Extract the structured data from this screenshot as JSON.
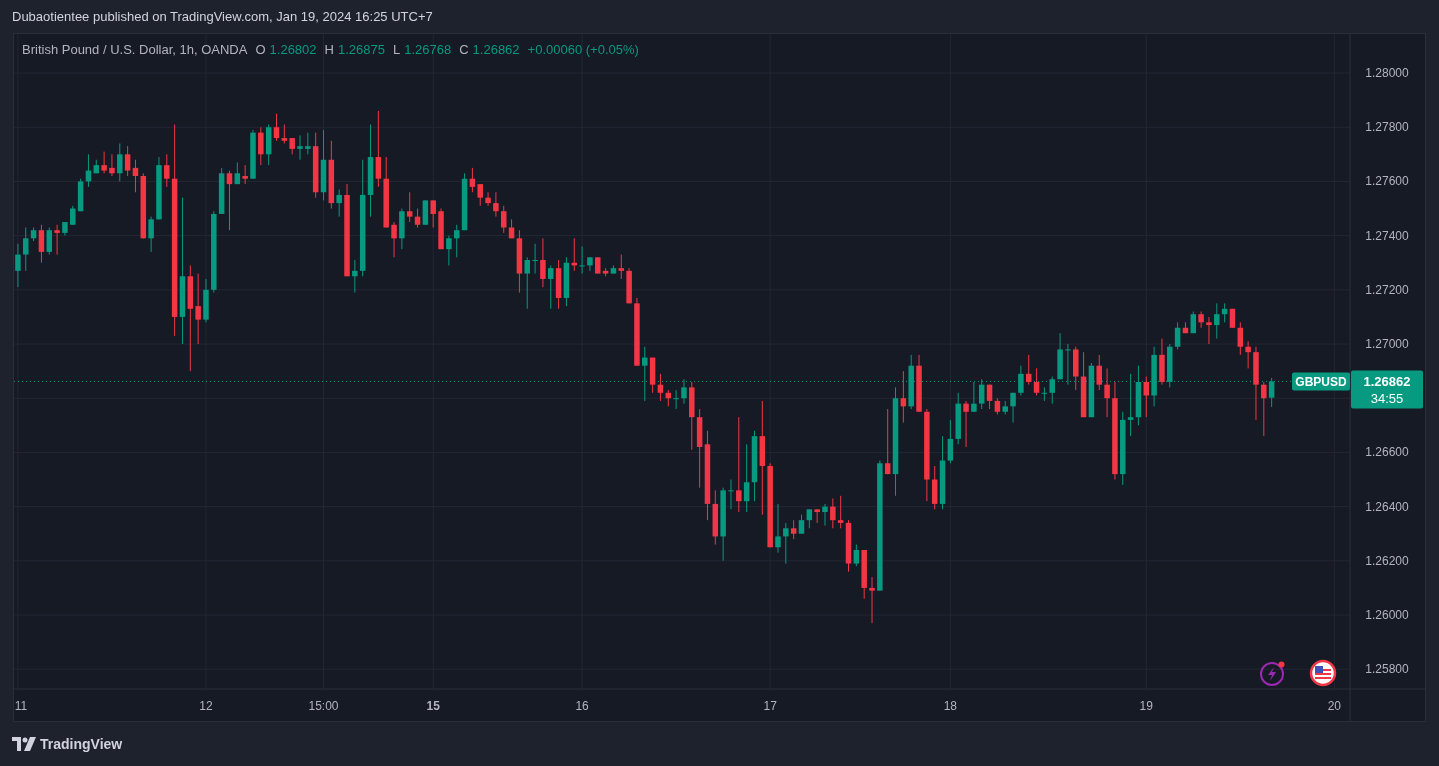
{
  "header": {
    "text": "Dubaotientee published on TradingView.com, Jan 19, 2024 16:25 UTC+7"
  },
  "legend": {
    "title": "British Pound / U.S. Dollar, 1h, OANDA",
    "ohlc": [
      {
        "label": "O",
        "value": "1.26802"
      },
      {
        "label": "H",
        "value": "1.26875"
      },
      {
        "label": "L",
        "value": "1.26768"
      },
      {
        "label": "C",
        "value": "1.26862"
      }
    ],
    "change": "+0.00060 (+0.05%)"
  },
  "price_tag": {
    "price": "1.26862",
    "countdown": "34:55"
  },
  "chart_data": {
    "type": "candlestick",
    "grid": true,
    "ref_lines": [
      {
        "axis": "y",
        "value": 1.26862
      }
    ],
    "ylim": [
      1.25727,
      1.28144
    ],
    "yticks": [
      {
        "value": 1.258,
        "label": "1.25800"
      },
      {
        "value": 1.26,
        "label": "1.26000"
      },
      {
        "value": 1.262,
        "label": "1.26200"
      },
      {
        "value": 1.264,
        "label": "1.26400"
      },
      {
        "value": 1.266,
        "label": "1.26600"
      },
      {
        "value": 1.27,
        "label": "1.27000"
      },
      {
        "value": 1.272,
        "label": "1.27200"
      },
      {
        "value": 1.274,
        "label": "1.27400"
      },
      {
        "value": 1.276,
        "label": "1.27600"
      },
      {
        "value": 1.278,
        "label": "1.27800"
      },
      {
        "value": 1.28,
        "label": "1.28000"
      }
    ],
    "categories": [
      "11",
      null,
      null,
      null,
      null,
      null,
      null,
      null,
      null,
      null,
      null,
      null,
      null,
      null,
      null,
      null,
      null,
      null,
      null,
      null,
      null,
      null,
      null,
      null,
      "12",
      null,
      null,
      null,
      null,
      null,
      null,
      null,
      null,
      null,
      null,
      null,
      null,
      null,
      null,
      "15:00",
      null,
      null,
      null,
      null,
      null,
      null,
      null,
      null,
      null,
      null,
      null,
      null,
      null,
      "**15**",
      null,
      null,
      null,
      null,
      null,
      null,
      null,
      null,
      null,
      null,
      null,
      null,
      null,
      null,
      null,
      null,
      null,
      null,
      "16",
      null,
      null,
      null,
      null,
      null,
      null,
      null,
      null,
      null,
      null,
      null,
      null,
      null,
      null,
      null,
      null,
      null,
      null,
      null,
      null,
      null,
      null,
      null,
      "17",
      null,
      null,
      null,
      null,
      null,
      null,
      null,
      null,
      null,
      null,
      null,
      null,
      null,
      null,
      null,
      null,
      null,
      null,
      null,
      null,
      null,
      null,
      "18",
      null,
      null,
      null,
      null,
      null,
      null,
      null,
      null,
      null,
      null,
      null,
      null,
      null,
      null,
      null,
      null,
      null,
      null,
      null,
      null,
      null,
      null,
      null,
      null,
      "19",
      null,
      null,
      null,
      null,
      null,
      null,
      null,
      null,
      null,
      null,
      null,
      null,
      null,
      null,
      null,
      null,
      null,
      null,
      null,
      null,
      null,
      null,
      null,
      "20"
    ],
    "series": [
      {
        "name": "GBPUSD",
        "ohlc": [
          [
            1.2727,
            1.2737,
            1.2721,
            1.2733
          ],
          [
            1.2733,
            1.2743,
            1.2727,
            1.2739
          ],
          [
            1.2739,
            1.2743,
            1.2738,
            1.2742
          ],
          [
            1.2742,
            1.2744,
            1.273,
            1.2734
          ],
          [
            1.2734,
            1.2743,
            1.2733,
            1.2742
          ],
          [
            1.2742,
            1.2744,
            1.2733,
            1.2741
          ],
          [
            1.2741,
            1.2745,
            1.274,
            1.2745
          ],
          [
            1.2744,
            1.2751,
            1.2744,
            1.275
          ],
          [
            1.2749,
            1.2761,
            1.2749,
            1.276
          ],
          [
            1.276,
            1.277,
            1.2758,
            1.2764
          ],
          [
            1.2763,
            1.2768,
            1.2763,
            1.2766
          ],
          [
            1.2766,
            1.2771,
            1.2763,
            1.2764
          ],
          [
            1.2765,
            1.277,
            1.2762,
            1.2763
          ],
          [
            1.2763,
            1.2774,
            1.276,
            1.277
          ],
          [
            1.277,
            1.2773,
            1.2762,
            1.2764
          ],
          [
            1.2765,
            1.2768,
            1.2756,
            1.2762
          ],
          [
            1.2762,
            1.2763,
            1.2739,
            1.2739
          ],
          [
            1.2739,
            1.2747,
            1.2734,
            1.2746
          ],
          [
            1.2746,
            1.2769,
            1.2746,
            1.2766
          ],
          [
            1.2766,
            1.277,
            1.2758,
            1.2761
          ],
          [
            1.2761,
            1.2781,
            1.2703,
            1.271
          ],
          [
            1.271,
            1.2754,
            1.27,
            1.2725
          ],
          [
            1.2725,
            1.2729,
            1.269,
            1.2713
          ],
          [
            1.2714,
            1.2726,
            1.27,
            1.2709
          ],
          [
            1.2709,
            1.2724,
            1.2708,
            1.272
          ],
          [
            1.272,
            1.2749,
            1.2719,
            1.2748
          ],
          [
            1.2748,
            1.2765,
            1.2748,
            1.2763
          ],
          [
            1.2763,
            1.2764,
            1.2742,
            1.2759
          ],
          [
            1.2759,
            1.2767,
            1.2759,
            1.2763
          ],
          [
            1.2762,
            1.2766,
            1.2759,
            1.2761
          ],
          [
            1.2761,
            1.2779,
            1.2761,
            1.2778
          ],
          [
            1.2778,
            1.278,
            1.2766,
            1.277
          ],
          [
            1.277,
            1.2781,
            1.2766,
            1.278
          ],
          [
            1.278,
            1.2785,
            1.2775,
            1.2776
          ],
          [
            1.2776,
            1.2781,
            1.2774,
            1.2775
          ],
          [
            1.2776,
            1.2776,
            1.277,
            1.2772
          ],
          [
            1.2772,
            1.2777,
            1.2768,
            1.2773
          ],
          [
            1.2772,
            1.2778,
            1.277,
            1.2773
          ],
          [
            1.2773,
            1.2778,
            1.2754,
            1.2756
          ],
          [
            1.2756,
            1.2779,
            1.2753,
            1.2768
          ],
          [
            1.2768,
            1.2775,
            1.275,
            1.2752
          ],
          [
            1.2752,
            1.2757,
            1.2747,
            1.2755
          ],
          [
            1.2755,
            1.2759,
            1.2725,
            1.2725
          ],
          [
            1.2725,
            1.2731,
            1.2719,
            1.2727
          ],
          [
            1.2727,
            1.2768,
            1.2725,
            1.2755
          ],
          [
            1.2755,
            1.2781,
            1.2747,
            1.2769
          ],
          [
            1.2769,
            1.2786,
            1.2758,
            1.2761
          ],
          [
            1.2761,
            1.2769,
            1.2743,
            1.2743
          ],
          [
            1.2744,
            1.2745,
            1.2732,
            1.2739
          ],
          [
            1.2739,
            1.275,
            1.2735,
            1.2749
          ],
          [
            1.2749,
            1.2756,
            1.2745,
            1.2747
          ],
          [
            1.2747,
            1.275,
            1.2743,
            1.2744
          ],
          [
            1.2744,
            1.2753,
            1.2744,
            1.2753
          ],
          [
            1.2753,
            1.2753,
            1.2743,
            1.2748
          ],
          [
            1.2749,
            1.275,
            1.2735,
            1.2735
          ],
          [
            1.2735,
            1.274,
            1.2729,
            1.2739
          ],
          [
            1.2739,
            1.2744,
            1.2732,
            1.2742
          ],
          [
            1.2742,
            1.2763,
            1.2742,
            1.2761
          ],
          [
            1.2761,
            1.2765,
            1.2756,
            1.2758
          ],
          [
            1.2759,
            1.2759,
            1.2751,
            1.2754
          ],
          [
            1.2754,
            1.2756,
            1.2751,
            1.2752
          ],
          [
            1.2752,
            1.2756,
            1.2747,
            1.2749
          ],
          [
            1.2749,
            1.2751,
            1.2741,
            1.2743
          ],
          [
            1.2743,
            1.2746,
            1.2739,
            1.2739
          ],
          [
            1.2739,
            1.2742,
            1.2719,
            1.2726
          ],
          [
            1.2726,
            1.2732,
            1.2713,
            1.2731
          ],
          [
            1.2731,
            1.2737,
            1.2726,
            1.2731
          ],
          [
            1.2731,
            1.2739,
            1.2721,
            1.2724
          ],
          [
            1.2724,
            1.2729,
            1.2713,
            1.2728
          ],
          [
            1.2728,
            1.2731,
            1.2713,
            1.2717
          ],
          [
            1.2717,
            1.2732,
            1.2714,
            1.273
          ],
          [
            1.273,
            1.2739,
            1.2727,
            1.2729
          ],
          [
            1.2729,
            1.2736,
            1.2726,
            1.2729
          ],
          [
            1.2729,
            1.2732,
            1.2727,
            1.2732
          ],
          [
            1.2732,
            1.2732,
            1.2726,
            1.2726
          ],
          [
            1.2727,
            1.2728,
            1.2725,
            1.2726
          ],
          [
            1.2726,
            1.2729,
            1.2726,
            1.2728
          ],
          [
            1.2728,
            1.2733,
            1.2724,
            1.2727
          ],
          [
            1.2727,
            1.2728,
            1.2715,
            1.2715
          ],
          [
            1.2715,
            1.2717,
            1.2692,
            1.2692
          ],
          [
            1.2692,
            1.2699,
            1.2679,
            1.2695
          ],
          [
            1.2695,
            1.2695,
            1.2682,
            1.2685
          ],
          [
            1.2685,
            1.2689,
            1.2679,
            1.2682
          ],
          [
            1.2682,
            1.2683,
            1.2677,
            1.268
          ],
          [
            1.268,
            1.2683,
            1.2676,
            1.268
          ],
          [
            1.268,
            1.2687,
            1.2678,
            1.2684
          ],
          [
            1.2684,
            1.2686,
            1.2661,
            1.2673
          ],
          [
            1.2673,
            1.2676,
            1.2647,
            1.2662
          ],
          [
            1.2663,
            1.2668,
            1.2635,
            1.2641
          ],
          [
            1.2641,
            1.2646,
            1.2626,
            1.2629
          ],
          [
            1.2629,
            1.2647,
            1.262,
            1.2646
          ],
          [
            1.2646,
            1.265,
            1.2639,
            1.2646
          ],
          [
            1.2646,
            1.2673,
            1.2638,
            1.2642
          ],
          [
            1.2642,
            1.2663,
            1.2638,
            1.2649
          ],
          [
            1.2649,
            1.2668,
            1.2642,
            1.2666
          ],
          [
            1.2666,
            1.2679,
            1.2637,
            1.2655
          ],
          [
            1.2655,
            1.2656,
            1.2625,
            1.2625
          ],
          [
            1.2625,
            1.2641,
            1.2623,
            1.2629
          ],
          [
            1.2629,
            1.2634,
            1.2619,
            1.2632
          ],
          [
            1.2632,
            1.2635,
            1.2628,
            1.263
          ],
          [
            1.263,
            1.2637,
            1.263,
            1.2635
          ],
          [
            1.2635,
            1.2639,
            1.2632,
            1.2639
          ],
          [
            1.2639,
            1.2639,
            1.2634,
            1.2638
          ],
          [
            1.2638,
            1.2641,
            1.2633,
            1.264
          ],
          [
            1.264,
            1.2643,
            1.2632,
            1.2635
          ],
          [
            1.2635,
            1.2644,
            1.2632,
            1.2634
          ],
          [
            1.2634,
            1.2635,
            1.2616,
            1.2619
          ],
          [
            1.2619,
            1.2626,
            1.2618,
            1.2624
          ],
          [
            1.2624,
            1.2624,
            1.2606,
            1.261
          ],
          [
            1.261,
            1.2614,
            1.2597,
            1.2609
          ],
          [
            1.2609,
            1.2657,
            1.2609,
            1.2656
          ],
          [
            1.2656,
            1.2676,
            1.2652,
            1.2652
          ],
          [
            1.2652,
            1.2684,
            1.2644,
            1.268
          ],
          [
            1.268,
            1.269,
            1.2671,
            1.2677
          ],
          [
            1.2677,
            1.2696,
            1.2676,
            1.2692
          ],
          [
            1.2692,
            1.2696,
            1.2675,
            1.2675
          ],
          [
            1.2675,
            1.2676,
            1.2642,
            1.265
          ],
          [
            1.265,
            1.2655,
            1.2639,
            1.2641
          ],
          [
            1.2641,
            1.2666,
            1.2639,
            1.2657
          ],
          [
            1.2657,
            1.2672,
            1.2656,
            1.2665
          ],
          [
            1.2665,
            1.2682,
            1.2663,
            1.2678
          ],
          [
            1.2678,
            1.2679,
            1.2662,
            1.2675
          ],
          [
            1.2675,
            1.2686,
            1.2675,
            1.2678
          ],
          [
            1.2678,
            1.2687,
            1.2676,
            1.2685
          ],
          [
            1.2685,
            1.2685,
            1.2676,
            1.2679
          ],
          [
            1.2679,
            1.268,
            1.2674,
            1.2675
          ],
          [
            1.2675,
            1.2679,
            1.2674,
            1.2677
          ],
          [
            1.2677,
            1.2682,
            1.2671,
            1.2682
          ],
          [
            1.2682,
            1.2692,
            1.2681,
            1.2689
          ],
          [
            1.2689,
            1.2696,
            1.2685,
            1.2686
          ],
          [
            1.2686,
            1.2691,
            1.2681,
            1.2682
          ],
          [
            1.2682,
            1.2684,
            1.2679,
            1.2682
          ],
          [
            1.2682,
            1.2688,
            1.2678,
            1.2687
          ],
          [
            1.2687,
            1.2704,
            1.2687,
            1.2698
          ],
          [
            1.2698,
            1.27,
            1.2685,
            1.2698
          ],
          [
            1.2698,
            1.2699,
            1.2683,
            1.2688
          ],
          [
            1.2688,
            1.2697,
            1.2673,
            1.2673
          ],
          [
            1.2673,
            1.2693,
            1.2673,
            1.2692
          ],
          [
            1.2692,
            1.2696,
            1.2683,
            1.2685
          ],
          [
            1.2685,
            1.2691,
            1.2673,
            1.268
          ],
          [
            1.268,
            1.2686,
            1.265,
            1.2652
          ],
          [
            1.2652,
            1.2675,
            1.2648,
            1.2672
          ],
          [
            1.2672,
            1.2689,
            1.2666,
            1.2673
          ],
          [
            1.2673,
            1.2692,
            1.267,
            1.2686
          ],
          [
            1.2686,
            1.2688,
            1.2673,
            1.2681
          ],
          [
            1.2681,
            1.2699,
            1.2677,
            1.2696
          ],
          [
            1.2696,
            1.2702,
            1.2685,
            1.2686
          ],
          [
            1.2686,
            1.27,
            1.2684,
            1.2699
          ],
          [
            1.2699,
            1.2708,
            1.2698,
            1.2706
          ],
          [
            1.2706,
            1.2708,
            1.2704,
            1.2704
          ],
          [
            1.2704,
            1.2712,
            1.2704,
            1.2711
          ],
          [
            1.2711,
            1.2712,
            1.2706,
            1.2708
          ],
          [
            1.2708,
            1.271,
            1.27,
            1.2707
          ],
          [
            1.2707,
            1.2715,
            1.2702,
            1.2711
          ],
          [
            1.2711,
            1.2715,
            1.2708,
            1.2713
          ],
          [
            1.2713,
            1.2713,
            1.2706,
            1.2706
          ],
          [
            1.2706,
            1.2708,
            1.2696,
            1.2699
          ],
          [
            1.2699,
            1.2701,
            1.2691,
            1.2697
          ],
          [
            1.2697,
            1.2699,
            1.2672,
            1.2685
          ],
          [
            1.2685,
            1.2686,
            1.2666,
            1.268
          ],
          [
            1.26802,
            1.26875,
            1.26768,
            1.26862
          ],
          null,
          null,
          null,
          null,
          null,
          null,
          null,
          null
        ]
      }
    ]
  },
  "footer": {
    "brand": "TradingView"
  }
}
